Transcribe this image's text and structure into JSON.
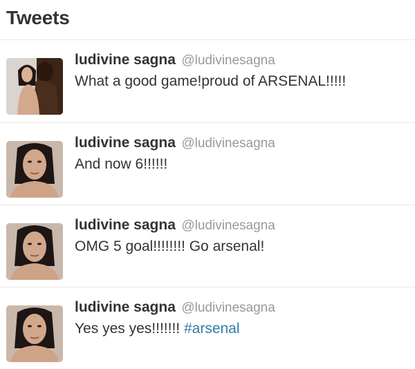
{
  "header": {
    "title": "Tweets"
  },
  "tweets": [
    {
      "name": "ludivine sagna",
      "handle": "@ludivinesagna",
      "text": "What a good game!proud of ARSENAL!!!!!",
      "hashtag": ""
    },
    {
      "name": "ludivine sagna",
      "handle": "@ludivinesagna",
      "text": "And now 6!!!!!!",
      "hashtag": ""
    },
    {
      "name": "ludivine sagna",
      "handle": "@ludivinesagna",
      "text": "OMG 5 goal!!!!!!!! Go arsenal!",
      "hashtag": ""
    },
    {
      "name": "ludivine sagna",
      "handle": "@ludivinesagna",
      "text": "Yes yes yes!!!!!!! ",
      "hashtag": "#arsenal"
    }
  ]
}
